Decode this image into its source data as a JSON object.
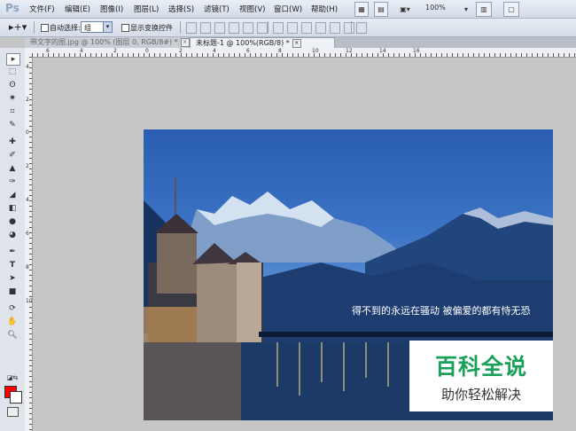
{
  "app": {
    "logo": "Ps"
  },
  "menu": {
    "items": [
      "文件(F)",
      "编辑(E)",
      "图像(I)",
      "图层(L)",
      "选择(S)",
      "滤镜(T)",
      "视图(V)",
      "窗口(W)",
      "帮助(H)"
    ],
    "zoom": "100%"
  },
  "options": {
    "auto_select_label": "自动选择:",
    "auto_select_value": "组",
    "show_transform_label": "显示变换控件"
  },
  "tabs": [
    {
      "label": "带文字的图.jpg @ 100% (图层 0, RGB/8#) *",
      "active": false
    },
    {
      "label": "未标题-1 @ 100%(RGB/8) *",
      "active": true
    }
  ],
  "rulers": {
    "top": [
      "6",
      "4",
      "2",
      "0",
      "2",
      "4",
      "6",
      "8",
      "10",
      "12",
      "14",
      "16"
    ],
    "left": [
      "4",
      "2",
      "0",
      "2",
      "4",
      "6",
      "8",
      "10"
    ]
  },
  "colors": {
    "foreground": "#ff0000",
    "background": "#ffffff",
    "watermark_green": "#1aa05a"
  },
  "canvas": {
    "caption": "得不到的永远在骚动 被偏爱的都有恃无恐",
    "watermark_title": "百科全说",
    "watermark_subtitle": "助你轻松解决"
  }
}
